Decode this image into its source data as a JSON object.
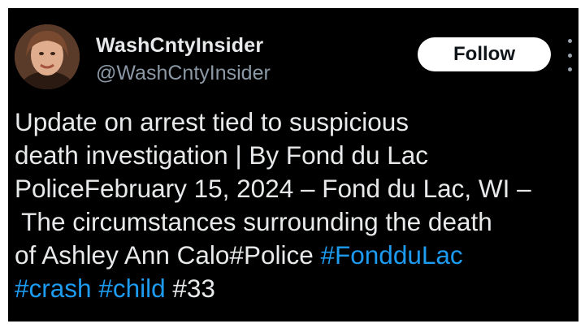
{
  "author": {
    "display_name": "WashCntyInsider",
    "handle": "@WashCntyInsider"
  },
  "follow_button": {
    "label": "Follow"
  },
  "post": {
    "lines": [
      [
        "Update on arrest tied to suspicious"
      ],
      [
        "death investigation | By Fond du Lac"
      ],
      [
        "PoliceFebruary 15, 2024 – Fond du Lac, WI –"
      ],
      [
        " The circumstances surrounding the death"
      ],
      [
        "of Ashley Ann Calo#Police ",
        "#FondduLac"
      ],
      [
        "#crash",
        " ",
        "#child",
        " #33"
      ]
    ]
  },
  "colors": {
    "background": "#000000",
    "text": "#e7e9ea",
    "secondary_text": "#8b98a5",
    "hashtag": "#1d9bf0",
    "follow_bg": "#ffffff",
    "follow_text": "#0f1419"
  },
  "icons": {
    "more": "more-dots-icon"
  }
}
